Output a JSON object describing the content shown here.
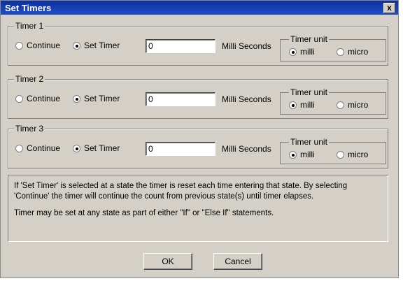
{
  "window": {
    "title": "Set Timers",
    "close_label": "x"
  },
  "timers": [
    {
      "label": "Timer 1",
      "continue_label": "Continue",
      "set_label": "Set Timer",
      "value": "0",
      "units_text": "Milli Seconds",
      "unit_title": "Timer unit",
      "milli_label": "milli",
      "micro_label": "micro"
    },
    {
      "label": "Timer 2",
      "continue_label": "Continue",
      "set_label": "Set Timer",
      "value": "0",
      "units_text": "Milli Seconds",
      "unit_title": "Timer unit",
      "milli_label": "milli",
      "micro_label": "micro"
    },
    {
      "label": "Timer 3",
      "continue_label": "Continue",
      "set_label": "Set Timer",
      "value": "0",
      "units_text": "Milli Seconds",
      "unit_title": "Timer unit",
      "milli_label": "milli",
      "micro_label": "micro"
    }
  ],
  "info": {
    "line1": "If 'Set Timer' is selected at a state the timer is reset each time entering that state. By selecting 'Continue' the timer will continue the count from previous state(s) until timer elapses.",
    "line2": "Timer may be set at any state as part of either \"If\" or \"Else If\" statements."
  },
  "buttons": {
    "ok": "OK",
    "cancel": "Cancel"
  },
  "colors": {
    "titlebar": "#1a3fb8",
    "dialog": "#d4d0c8"
  }
}
